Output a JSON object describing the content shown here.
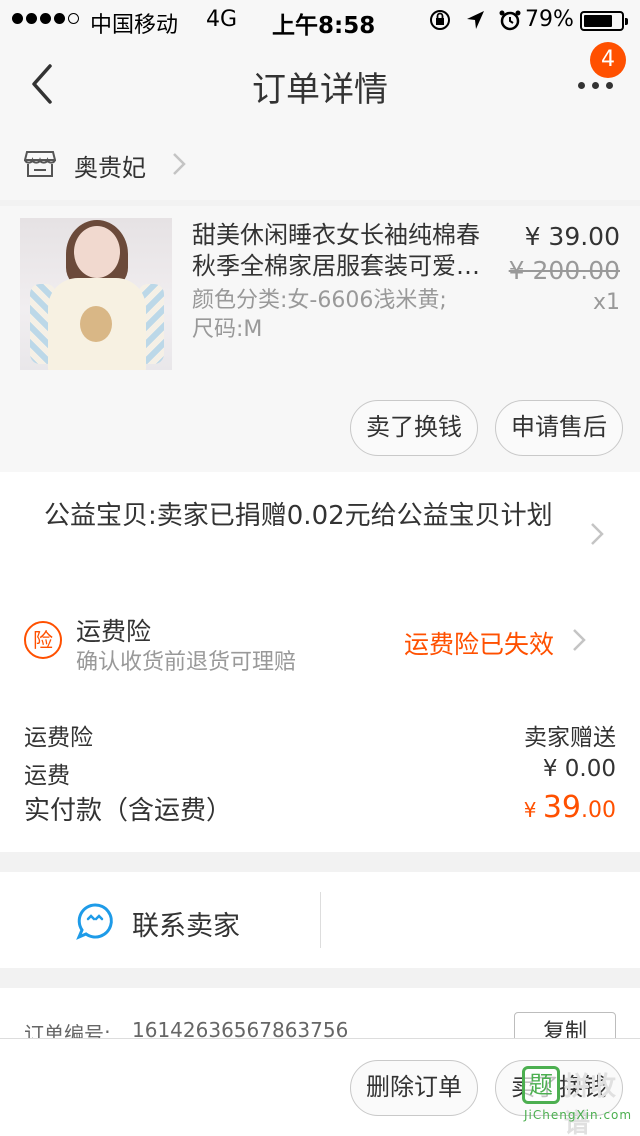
{
  "status_bar": {
    "carrier": "中国移动",
    "network": "4G",
    "time": "上午8:58",
    "battery": "79%",
    "battery_level": 0.79
  },
  "nav": {
    "title": "订单详情",
    "badge": "4"
  },
  "shop": {
    "name": "奥贵妃"
  },
  "item": {
    "name": "甜美休闲睡衣女长袖纯棉春秋季全棉家居服套装可爱…",
    "sku_color": "颜色分类:女-6606浅米黄;",
    "sku_size": "尺码:M",
    "price": "¥ 39.00",
    "original_price": "¥ 200.00",
    "quantity": "x1",
    "btn_resell": "卖了换钱",
    "btn_aftersale": "申请售后"
  },
  "donation": {
    "text": "公益宝贝:卖家已捐赠0.02元给公益宝贝计划"
  },
  "insurance": {
    "icon_char": "险",
    "title": "运费险",
    "subtitle": "确认收货前退货可理赔",
    "status": "运费险已失效",
    "status_color": "#ff5000"
  },
  "summary": {
    "insurance_label": "运费险",
    "insurance_value": "卖家赠送",
    "shipping_label": "运费",
    "shipping_value": "¥ 0.00",
    "paid_label": "实付款（含运费）",
    "paid_currency": "¥ ",
    "paid_int": "39",
    "paid_dec": ".00"
  },
  "contact": {
    "label": "联系卖家"
  },
  "order_info": {
    "number_label": "订单编号:",
    "number_value": "16142636567863756",
    "copy_label": "复制"
  },
  "bottom_bar": {
    "delete_label": "删除订单",
    "resell_label": "卖了换钱"
  },
  "watermark": {
    "logo_char": "题",
    "name": "拼收谱",
    "url": "JiChengXin.com"
  },
  "icons": {
    "back": "chevron-left-icon",
    "more": "more-dots-icon",
    "shop": "store-icon",
    "chevron": "chevron-right-icon",
    "insurance": "insurance-badge-icon",
    "contact": "chat-smile-icon"
  },
  "colors": {
    "accent": "#ff5000",
    "background": "#f2f2f2"
  }
}
